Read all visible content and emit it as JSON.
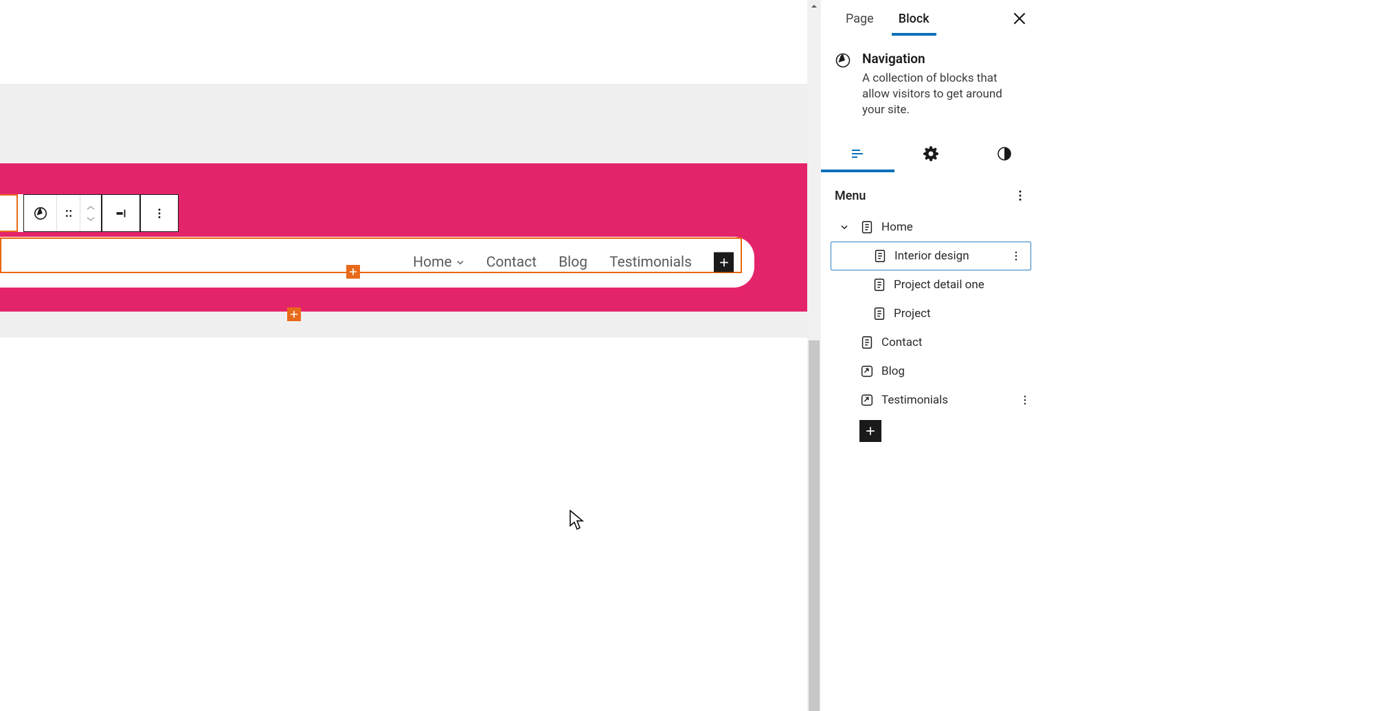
{
  "sidebar": {
    "tabs": {
      "page": "Page",
      "block": "Block"
    },
    "block_info": {
      "title": "Navigation",
      "description": "A collection of blocks that allow visitors to get around your site."
    },
    "menu_section_title": "Menu",
    "menu_items": {
      "home": "Home",
      "interior_design": "Interior design",
      "project_detail_one": "Project detail one",
      "project": "Project",
      "contact": "Contact",
      "blog": "Blog",
      "testimonials": "Testimonials"
    }
  },
  "canvas": {
    "nav_links": {
      "home": "Home",
      "contact": "Contact",
      "blog": "Blog",
      "testimonials": "Testimonials"
    }
  }
}
